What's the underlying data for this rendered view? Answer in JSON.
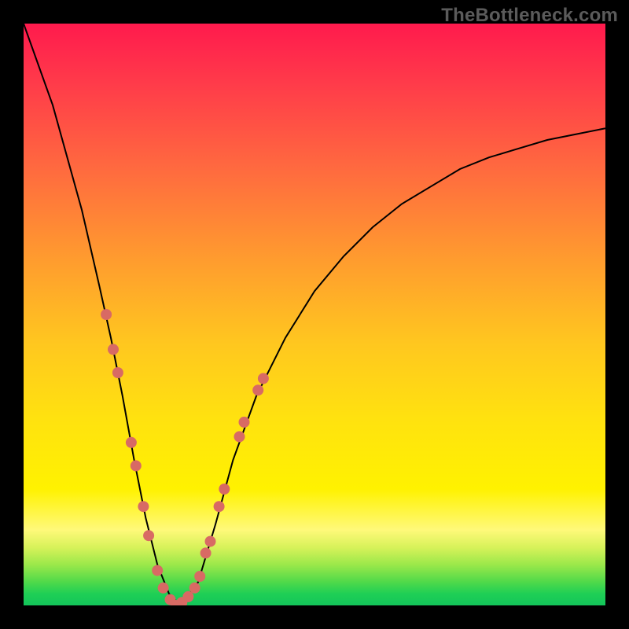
{
  "watermark": "TheBottleneck.com",
  "colors": {
    "page_bg": "#000000",
    "gradient_top": "#ff1a4d",
    "gradient_bottom": "#13c55a",
    "curve": "#000000",
    "markers": "#d86a64"
  },
  "chart_data": {
    "type": "line",
    "title": "",
    "xlabel": "",
    "ylabel": "",
    "xlim": [
      0,
      100
    ],
    "ylim": [
      0,
      100
    ],
    "grid": false,
    "series": [
      {
        "name": "bottleneck-curve",
        "x": [
          0,
          5,
          10,
          13,
          15,
          17,
          19,
          21,
          23,
          25,
          27,
          30,
          33,
          36,
          40,
          45,
          50,
          55,
          60,
          65,
          70,
          75,
          80,
          85,
          90,
          95,
          100
        ],
        "y": [
          100,
          86,
          68,
          55,
          46,
          36,
          25,
          15,
          7,
          2,
          0,
          4,
          14,
          25,
          36,
          46,
          54,
          60,
          65,
          69,
          72,
          75,
          77,
          78.5,
          80,
          81,
          82
        ]
      }
    ],
    "markers": [
      {
        "x": 14.2,
        "y": 50
      },
      {
        "x": 15.4,
        "y": 44
      },
      {
        "x": 16.2,
        "y": 40
      },
      {
        "x": 18.5,
        "y": 28
      },
      {
        "x": 19.3,
        "y": 24
      },
      {
        "x": 20.6,
        "y": 17
      },
      {
        "x": 21.5,
        "y": 12
      },
      {
        "x": 23.0,
        "y": 6
      },
      {
        "x": 24.0,
        "y": 3
      },
      {
        "x": 25.2,
        "y": 1
      },
      {
        "x": 26.2,
        "y": 0
      },
      {
        "x": 27.2,
        "y": 0.5
      },
      {
        "x": 28.3,
        "y": 1.5
      },
      {
        "x": 29.4,
        "y": 3
      },
      {
        "x": 30.3,
        "y": 5
      },
      {
        "x": 31.3,
        "y": 9
      },
      {
        "x": 32.1,
        "y": 11
      },
      {
        "x": 33.6,
        "y": 17
      },
      {
        "x": 34.5,
        "y": 20
      },
      {
        "x": 37.1,
        "y": 29
      },
      {
        "x": 37.9,
        "y": 31.5
      },
      {
        "x": 40.3,
        "y": 37
      },
      {
        "x": 41.2,
        "y": 39
      }
    ]
  }
}
